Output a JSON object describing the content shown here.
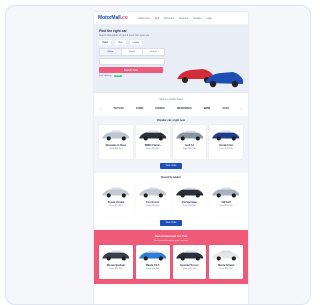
{
  "site": {
    "logo_main": "MotorMall",
    "logo_accent": ".co",
    "nav": [
      "Used Cars",
      "Sell",
      "Reviews",
      "Finance",
      "Guides",
      "Help"
    ]
  },
  "hero": {
    "title": "Find the right car",
    "subtitle": "Search thousands of new & used cars near you",
    "tabs": [
      "Used",
      "New",
      "Lease"
    ],
    "segments": [
      "Make",
      "Model",
      "Budget"
    ],
    "cta": "Search Cars",
    "promo_text": "Free delivery",
    "promo_tag": "NEW"
  },
  "brands": {
    "title": "Shop by popular brand",
    "items": [
      "TOYOTA",
      "FORD",
      "HONDA",
      "MERCEDES",
      "BMW",
      "AUDI"
    ]
  },
  "section_a": {
    "title": "Popular cars right now",
    "cards": [
      {
        "name": "Mercedes A-Class",
        "price": "From $28,900",
        "color": "#bfc5cf"
      },
      {
        "name": "BMW 3 Series",
        "price": "From $31,400",
        "color": "#2a2f3a"
      },
      {
        "name": "Audi A4",
        "price": "From $30,250",
        "color": "#8c939d"
      },
      {
        "name": "Honda Civic",
        "price": "From $22,100",
        "color": "#1f3d8f"
      }
    ],
    "button": "View more"
  },
  "section_b": {
    "title": "Recently added",
    "cards": [
      {
        "name": "Toyota Corolla",
        "price": "From $19,800",
        "color": "#c5cad2"
      },
      {
        "name": "Ford Focus",
        "price": "From $17,600",
        "color": "#c5cad2"
      },
      {
        "name": "Kia Sportage",
        "price": "From $24,300",
        "color": "#2a2f3a"
      },
      {
        "name": "VW Golf",
        "price": "From $21,900",
        "color": "#aab1bc"
      }
    ],
    "button": "View more"
  },
  "section_c": {
    "title": "Recommended for You",
    "subtitle": "Hand-picked based on your searches",
    "cards": [
      {
        "name": "Nissan Qashqai",
        "price": "From $23,500",
        "color": "#3a3f4a"
      },
      {
        "name": "Mazda CX-5",
        "price": "From $26,200",
        "color": "#2c7bd6"
      },
      {
        "name": "Hyundai Tucson",
        "price": "From $25,100",
        "color": "#2a2f3a"
      },
      {
        "name": "Skoda Octavia",
        "price": "From $20,700",
        "color": "#e5e7ea"
      }
    ]
  },
  "colors": {
    "accent": "#ee5a78",
    "brand": "#1d4fb8",
    "hero_car_1": "#d22c3b",
    "hero_car_2": "#1b4fb4"
  }
}
